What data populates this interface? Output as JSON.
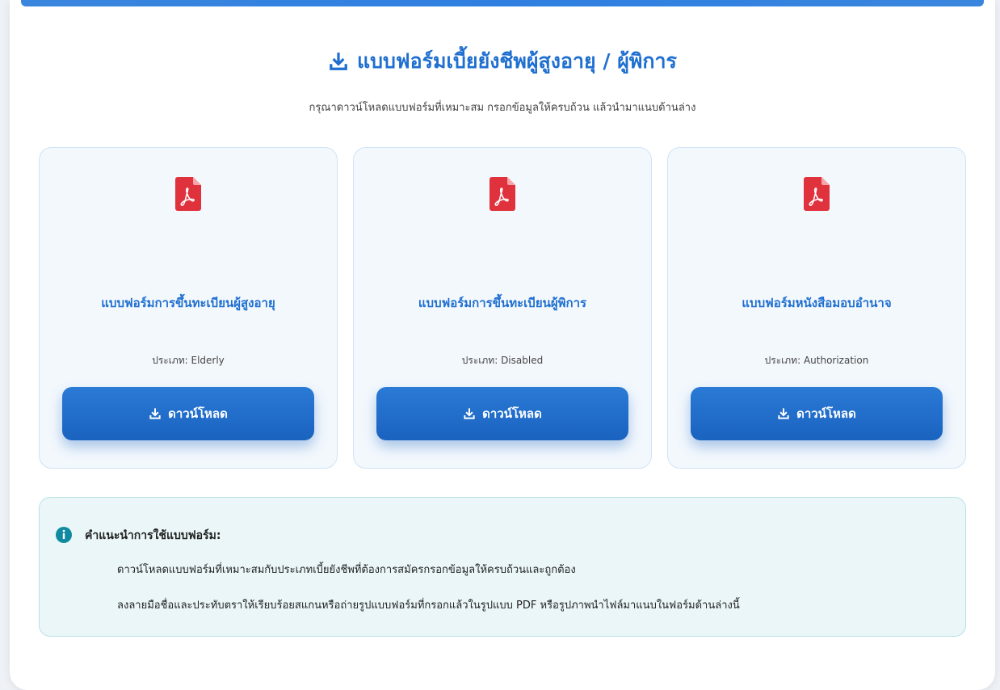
{
  "header": {
    "title": "แบบฟอร์มเบี้ยยังชีพผู้สูงอายุ / ผู้พิการ",
    "subtitle": "กรุณาดาวน์โหลดแบบฟอร์มที่เหมาะสม กรอกข้อมูลให้ครบถ้วน แล้วนำมาแนบด้านล่าง",
    "icon": "download-icon"
  },
  "cards": [
    {
      "title": "แบบฟอร์มการขึ้นทะเบียนผู้สูงอายุ",
      "type_label": "ประเภท: Elderly",
      "button_label": "ดาวน์โหลด",
      "icon": "pdf-file-icon"
    },
    {
      "title": "แบบฟอร์มการขึ้นทะเบียนผู้พิการ",
      "type_label": "ประเภท: Disabled",
      "button_label": "ดาวน์โหลด",
      "icon": "pdf-file-icon"
    },
    {
      "title": "แบบฟอร์มหนังสือมอบอำนาจ",
      "type_label": "ประเภท: Authorization",
      "button_label": "ดาวน์โหลด",
      "icon": "pdf-file-icon"
    }
  ],
  "info": {
    "heading": "คำแนะนำการใช้แบบฟอร์ม:",
    "lines": [
      "ดาวน์โหลดแบบฟอร์มที่เหมาะสมกับประเภทเบี้ยยังชีพที่ต้องการสมัครกรอกข้อมูลให้ครบถ้วนและถูกต้อง",
      "ลงลายมือชื่อและประทับตราให้เรียบร้อยสแกนหรือถ่ายรูปแบบฟอร์มที่กรอกแล้วในรูปแบบ PDF หรือรูปภาพนำไฟล์มาแนบในฟอร์มด้านล่างนี้"
    ],
    "icon": "info-icon"
  },
  "colors": {
    "accent": "#1f6fd0",
    "button": "#1a63bf",
    "pdf_red": "#e0323c",
    "info_teal": "#0f8aa0"
  }
}
